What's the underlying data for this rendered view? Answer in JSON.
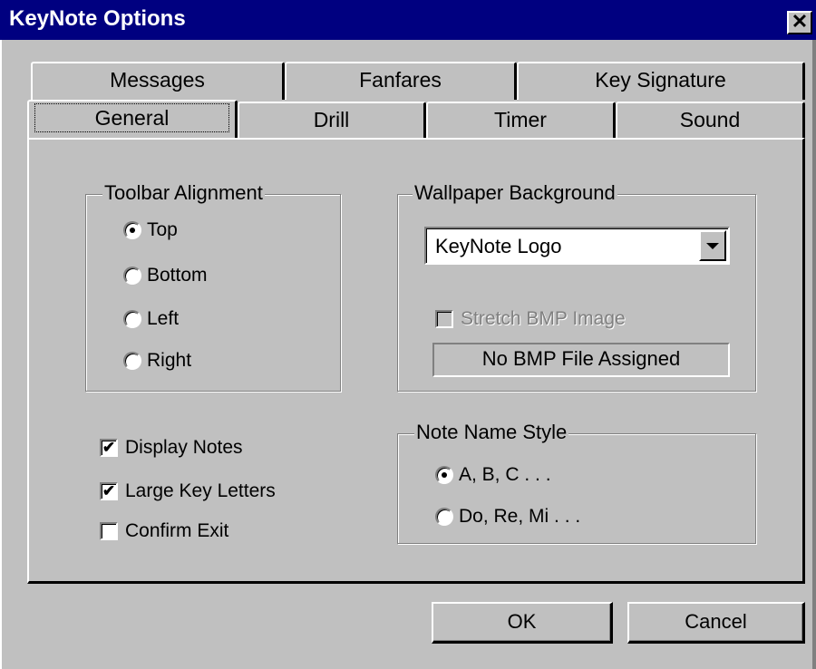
{
  "window": {
    "title": "KeyNote Options",
    "close_glyph": "✕"
  },
  "tabs": {
    "row_back": [
      {
        "label": "Messages"
      },
      {
        "label": "Fanfares"
      },
      {
        "label": "Key Signature"
      }
    ],
    "row_front": [
      {
        "label": "General",
        "selected": true
      },
      {
        "label": "Drill"
      },
      {
        "label": "Timer"
      },
      {
        "label": "Sound"
      }
    ]
  },
  "toolbar_alignment": {
    "legend": "Toolbar Alignment",
    "options": [
      {
        "label": "Top",
        "selected": true
      },
      {
        "label": "Bottom",
        "selected": false
      },
      {
        "label": "Left",
        "selected": false
      },
      {
        "label": "Right",
        "selected": false
      }
    ]
  },
  "wallpaper": {
    "legend": "Wallpaper Background",
    "selected": "KeyNote Logo",
    "stretch_label": "Stretch BMP Image",
    "stretch_checked": false,
    "stretch_enabled": false,
    "bmp_status": "No BMP File Assigned"
  },
  "options": {
    "display_notes": {
      "label": "Display Notes",
      "checked": true
    },
    "large_key_letters": {
      "label": "Large Key Letters",
      "checked": true
    },
    "confirm_exit": {
      "label": "Confirm Exit",
      "checked": false
    }
  },
  "note_name_style": {
    "legend": "Note Name Style",
    "options": [
      {
        "label": "A, B, C . . .",
        "selected": true
      },
      {
        "label": "Do, Re, Mi . . .",
        "selected": false
      }
    ]
  },
  "buttons": {
    "ok": "OK",
    "cancel": "Cancel"
  },
  "colors": {
    "titlebar": "#000080",
    "face": "#c0c0c0",
    "shadow": "#808080",
    "highlight": "#ffffff"
  },
  "icons": {
    "close": "close-icon",
    "dropdown": "chevron-down-icon",
    "check": "checkmark-icon"
  }
}
